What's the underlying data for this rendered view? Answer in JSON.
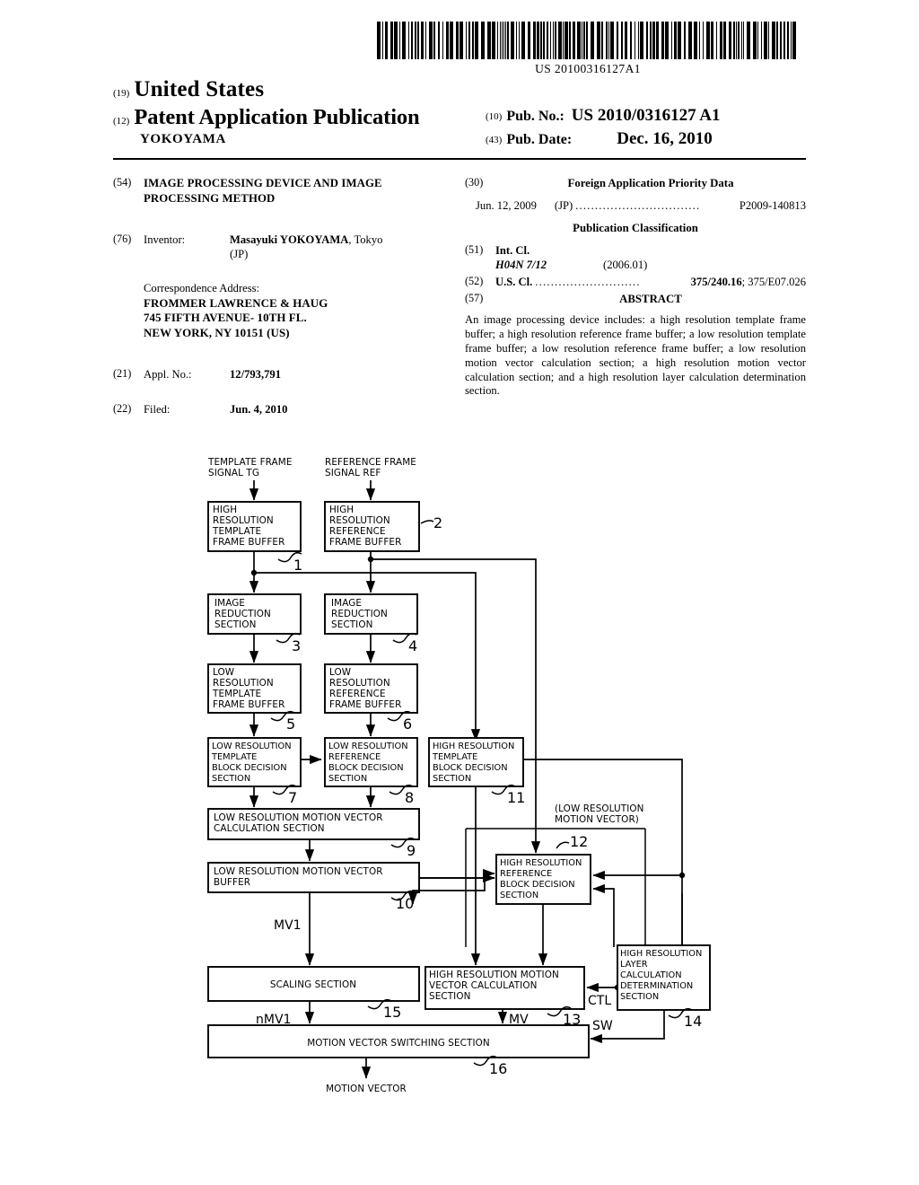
{
  "barcode": {
    "number": "US 20100316127A1"
  },
  "masthead": {
    "inid_19": "(19)",
    "country": "United States",
    "inid_12": "(12)",
    "doc_type": "Patent Application Publication",
    "applicant_name": "YOKOYAMA",
    "inid_10": "(10)",
    "pub_no_label": "Pub. No.:",
    "pub_no_value": "US 2010/0316127 A1",
    "inid_43": "(43)",
    "pub_date_label": "Pub. Date:",
    "pub_date_value": "Dec. 16, 2010"
  },
  "biblio_left": {
    "inid_54": "(54)",
    "title": "IMAGE PROCESSING DEVICE AND IMAGE PROCESSING METHOD",
    "inid_76": "(76)",
    "inventor_label": "Inventor:",
    "inventor_name": "Masayuki YOKOYAMA",
    "inventor_city": ", Tokyo",
    "inventor_country": "(JP)",
    "correspondence_label": "Correspondence Address:",
    "address_line_1": "FROMMER LAWRENCE & HAUG",
    "address_line_2": "745 FIFTH AVENUE- 10TH FL.",
    "address_line_3": "NEW YORK, NY 10151 (US)",
    "inid_21": "(21)",
    "appl_no_label": "Appl. No.:",
    "appl_no_value": "12/793,791",
    "inid_22": "(22)",
    "filed_label": "Filed:",
    "filed_value": "Jun. 4, 2010"
  },
  "biblio_right": {
    "inid_30": "(30)",
    "foreign_priority_heading": "Foreign Application Priority Data",
    "priority_date": "Jun. 12, 2009",
    "priority_country": "(JP)",
    "priority_dots": "................................",
    "priority_number": "P2009-140813",
    "publication_classification_heading": "Publication Classification",
    "inid_51": "(51)",
    "int_cl_label": "Int. Cl.",
    "int_cl_code": "H04N 7/12",
    "int_cl_version": "(2006.01)",
    "inid_52": "(52)",
    "us_cl_label": "U.S. Cl.",
    "us_cl_dots": "...........................",
    "us_cl_primary": "375/240.16",
    "us_cl_secondary": "; 375/E07.026",
    "inid_57": "(57)",
    "abstract_heading": "ABSTRACT",
    "abstract_text": "An image processing device includes: a high resolution template frame buffer; a high resolution reference frame buffer; a low resolution template frame buffer; a low resolution reference frame buffer; a low resolution motion vector calculation section; a high resolution motion vector calculation section; and a high resolution layer calculation determination section."
  },
  "diagram": {
    "input_labels": [
      {
        "id": "tg",
        "lines": [
          "TEMPLATE FRAME",
          "SIGNAL TG"
        ]
      },
      {
        "id": "ref",
        "lines": [
          "REFERENCE FRAME",
          "SIGNAL REF"
        ]
      }
    ],
    "blocks": [
      {
        "ref": "1",
        "lines": [
          "HIGH",
          "RESOLUTION",
          "TEMPLATE",
          "FRAME BUFFER"
        ]
      },
      {
        "ref": "2",
        "lines": [
          "HIGH",
          "RESOLUTION",
          "REFERENCE",
          "FRAME BUFFER"
        ]
      },
      {
        "ref": "3",
        "lines": [
          "IMAGE",
          "REDUCTION",
          "SECTION"
        ]
      },
      {
        "ref": "4",
        "lines": [
          "IMAGE",
          "REDUCTION",
          "SECTION"
        ]
      },
      {
        "ref": "5",
        "lines": [
          "LOW",
          "RESOLUTION",
          "TEMPLATE",
          "FRAME BUFFER"
        ]
      },
      {
        "ref": "6",
        "lines": [
          "LOW",
          "RESOLUTION",
          "REFERENCE",
          "FRAME BUFFER"
        ]
      },
      {
        "ref": "7",
        "lines": [
          "LOW RESOLUTION",
          "TEMPLATE",
          "BLOCK DECISION",
          "SECTION"
        ]
      },
      {
        "ref": "8",
        "lines": [
          "LOW RESOLUTION",
          "REFERENCE",
          "BLOCK DECISION",
          "SECTION"
        ]
      },
      {
        "ref": "11",
        "lines": [
          "HIGH RESOLUTION",
          "TEMPLATE",
          "BLOCK DECISION",
          "SECTION"
        ]
      },
      {
        "ref": "9",
        "lines": [
          "LOW RESOLUTION MOTION VECTOR",
          "CALCULATION SECTION"
        ]
      },
      {
        "ref": "12",
        "lines": [
          "HIGH RESOLUTION",
          "REFERENCE",
          "BLOCK DECISION",
          "SECTION"
        ]
      },
      {
        "ref": "10",
        "lines": [
          "LOW RESOLUTION MOTION VECTOR",
          "BUFFER"
        ]
      },
      {
        "ref": "15",
        "lines": [
          "SCALING SECTION"
        ]
      },
      {
        "ref": "13",
        "lines": [
          "HIGH RESOLUTION MOTION",
          "VECTOR CALCULATION",
          "SECTION"
        ]
      },
      {
        "ref": "14",
        "lines": [
          "HIGH RESOLUTION",
          "LAYER",
          "CALCULATION",
          "DETERMINATION",
          "SECTION"
        ]
      },
      {
        "ref": "16",
        "lines": [
          "MOTION VECTOR SWITCHING SECTION"
        ]
      }
    ],
    "annotations": [
      {
        "id": "low-res-mv-note",
        "lines": [
          "(LOW RESOLUTION",
          "MOTION VECTOR)"
        ]
      }
    ],
    "signal_labels": [
      {
        "id": "mv1",
        "text": "MV1"
      },
      {
        "id": "nmv1",
        "text": "nMV1"
      },
      {
        "id": "mv",
        "text": "MV"
      },
      {
        "id": "ctl",
        "text": "CTL"
      },
      {
        "id": "sw",
        "text": "SW"
      }
    ],
    "output_label": "MOTION VECTOR"
  }
}
